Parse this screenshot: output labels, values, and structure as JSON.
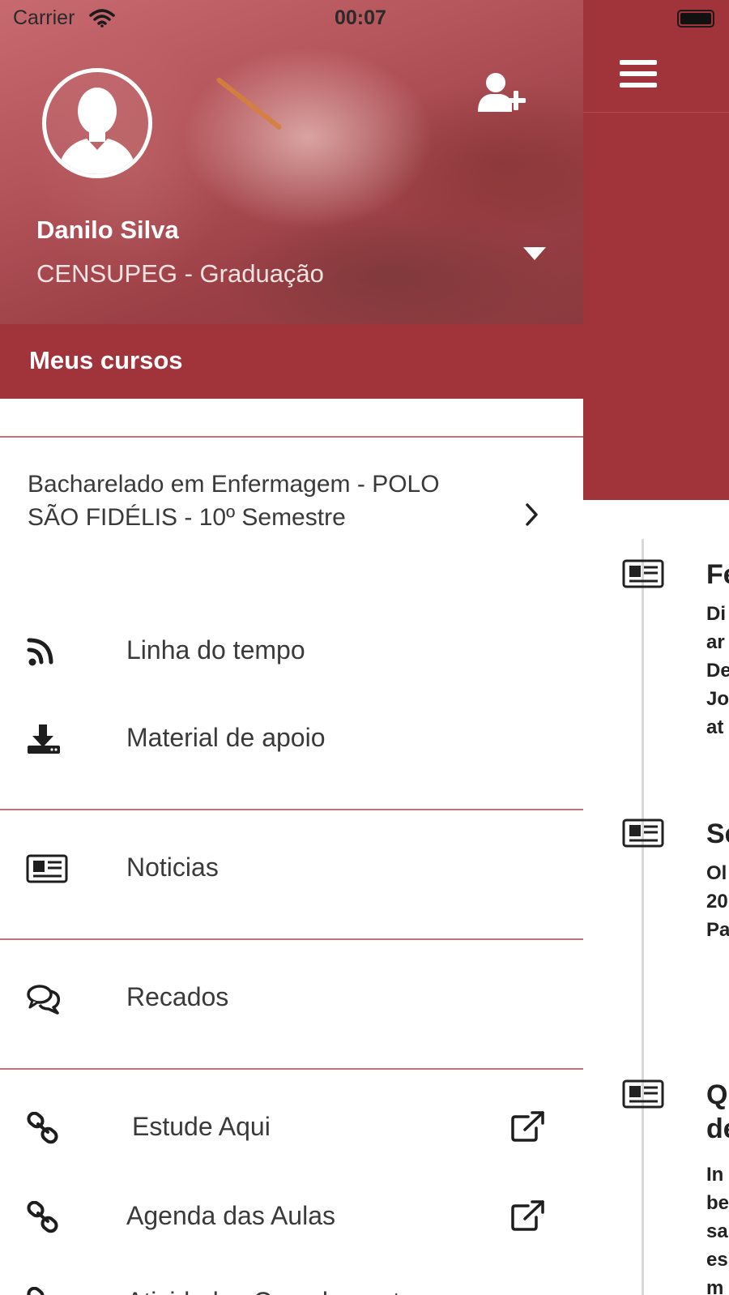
{
  "status_bar": {
    "carrier": "Carrier",
    "time": "00:07"
  },
  "drawer": {
    "user": {
      "name": "Danilo Silva",
      "organization": "CENSUPEG - Graduação"
    },
    "section_title": "Meus cursos",
    "course": {
      "label": "Bacharelado em Enfermagem - POLO SÃO FIDÉLIS - 10º Semestre"
    },
    "menu": [
      {
        "label": "Linha do tempo",
        "icon": "rss-icon"
      },
      {
        "label": "Material de apoio",
        "icon": "download-icon"
      },
      {
        "label": "Noticias",
        "icon": "newspaper-icon"
      },
      {
        "label": "Recados",
        "icon": "chat-icon"
      },
      {
        "label": "Estude Aqui",
        "icon": "link-icon",
        "external": true
      },
      {
        "label": "Agenda das Aulas",
        "icon": "link-icon",
        "external": true
      },
      {
        "label": "Atividades Complementares",
        "icon": "link-icon"
      }
    ]
  },
  "background_feed": [
    {
      "title": "Fe",
      "body": "Di\nar\nDe\nJo\nat"
    },
    {
      "title": "Se",
      "body": "Ol\n20\nPa"
    },
    {
      "title": "Q\nde",
      "body": "In\nbe\nsa\nes\nm"
    }
  ],
  "colors": {
    "accent": "#a1333a",
    "separator": "#c0757a",
    "text": "#3a3a3a"
  }
}
